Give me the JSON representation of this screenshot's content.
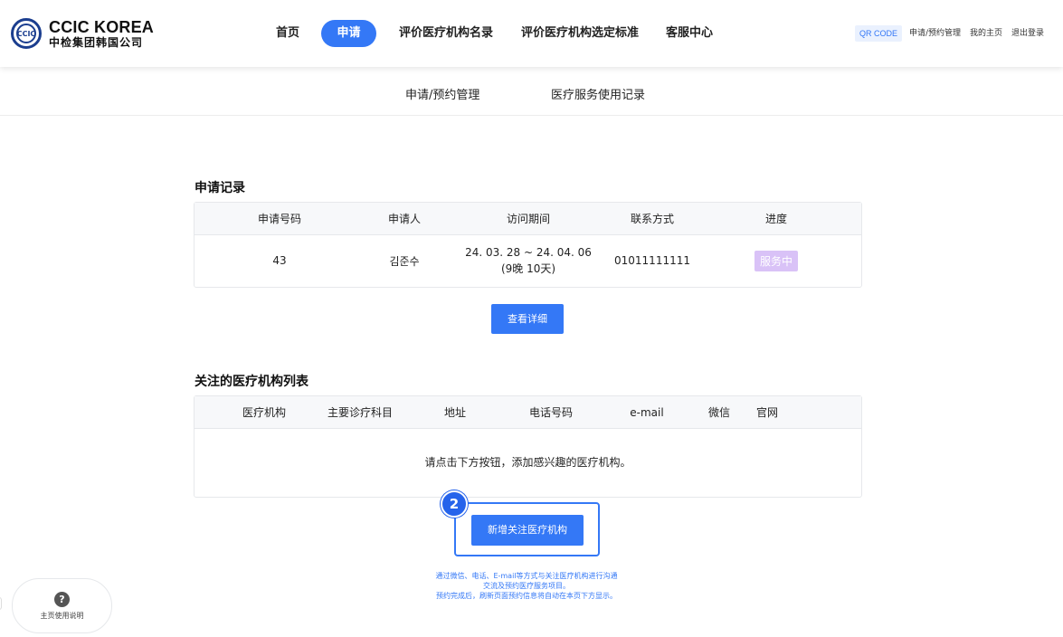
{
  "brand": {
    "name_en": "CCIC KOREA",
    "name_cn": "中检集团韩国公司",
    "mark": "CCIC"
  },
  "nav": {
    "items": [
      {
        "label": "首页"
      },
      {
        "label": "申请",
        "active": true
      },
      {
        "label": "评价医疗机构名录"
      },
      {
        "label": "评价医疗机构选定标准"
      },
      {
        "label": "客服中心"
      }
    ]
  },
  "utility": {
    "qr": "QR CODE",
    "apply_manage": "申请/预约管理",
    "my_page": "我的主页",
    "logout": "退出登录"
  },
  "subnav": {
    "items": [
      {
        "label": "申请/预约管理"
      },
      {
        "label": "医疗服务使用记录"
      }
    ]
  },
  "application_records": {
    "title": "申请记录",
    "headers": [
      "申请号码",
      "申请人",
      "访问期间",
      "联系方式",
      "进度"
    ],
    "rows": [
      {
        "number": "43",
        "applicant": "김준수",
        "period_line1": "24. 03. 28 ~ 24. 04. 06",
        "period_line2": "(9晚 10天)",
        "contact": "01011111111",
        "status": "服务中"
      }
    ],
    "detail_button": "查看详细"
  },
  "favorites": {
    "title": "关注的医疗机构列表",
    "headers": [
      "医疗机构",
      "主要诊疗科目",
      "地址",
      "电话号码",
      "e-mail",
      "微信",
      "官网"
    ],
    "empty_message": "请点击下方按钮，添加感兴趣的医疗机构。",
    "add_button": "新增关注医疗机构",
    "step": "2"
  },
  "notes": {
    "line1": "通过微信、电话、E-mail等方式与关注医疗机构进行沟通",
    "line2": "交流及预约医疗服务项目。",
    "line3": "预约完成后，刷新页面预约信息将自动在本页下方显示。"
  },
  "help": {
    "icon": "?",
    "label": "主页使用说明"
  },
  "colors": {
    "primary": "#3478f6",
    "status_badge": "#d9c2f7",
    "brand": "#1b3e8f"
  }
}
